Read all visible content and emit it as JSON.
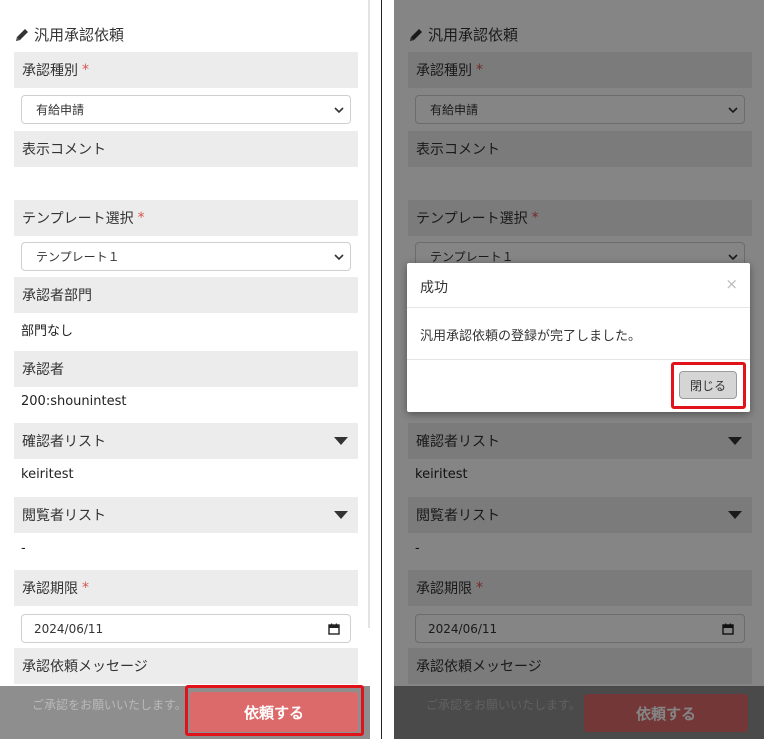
{
  "form": {
    "title": "汎用承認依頼",
    "approval_type": {
      "label": "承認種別",
      "required_mark": "*",
      "selected": "有給申請"
    },
    "display_comment": {
      "label": "表示コメント"
    },
    "template_select": {
      "label": "テンプレート選択",
      "required_mark": "*",
      "selected": "テンプレート１"
    },
    "approver_department": {
      "label": "承認者部門",
      "value": "部門なし"
    },
    "approver": {
      "label": "承認者",
      "value": "200:shounintest"
    },
    "confirmer_list": {
      "label": "確認者リスト",
      "value": "keiritest"
    },
    "viewer_list": {
      "label": "閲覧者リスト",
      "value": "-"
    },
    "approval_deadline": {
      "label": "承認期限",
      "required_mark": "*",
      "value": "2024/06/11"
    },
    "request_message": {
      "label": "承認依頼メッセージ",
      "placeholder": "ご承認をお願いいたします。"
    },
    "submit_label": "依頼する"
  },
  "modal": {
    "title": "成功",
    "close_x": "×",
    "message": "汎用承認依頼の登録が完了しました。",
    "close_button": "閉じる"
  },
  "colors": {
    "label_bg": "#ececec",
    "required": "#d9534f",
    "submit": "#dc6a6a",
    "highlight": "#e0121a",
    "overlay": "rgba(0,0,0,0.48)"
  },
  "icons": [
    "pencil-icon",
    "chevron-down-icon",
    "caret-down-icon",
    "calendar-icon"
  ]
}
